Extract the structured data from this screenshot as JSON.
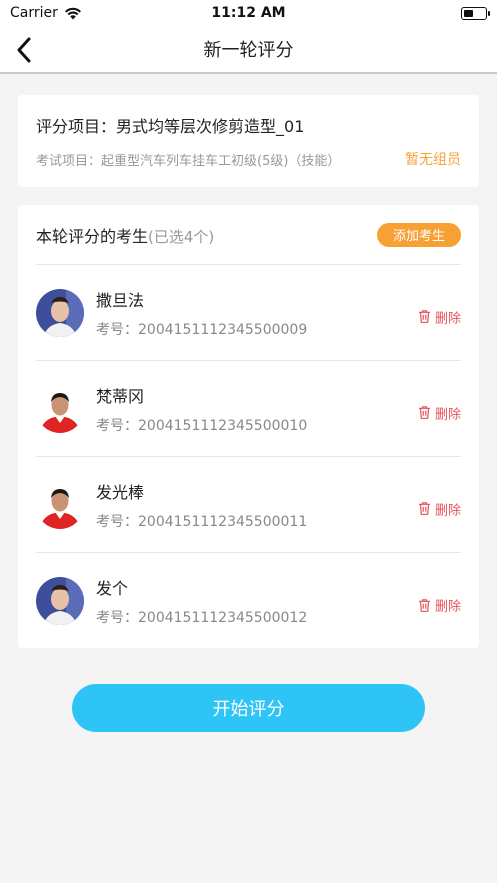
{
  "status_bar": {
    "carrier": "Carrier",
    "time": "11:12 AM"
  },
  "nav": {
    "title": "新一轮评分"
  },
  "project": {
    "label": "评分项目：",
    "name": "男式均等层次修剪造型_01",
    "exam_label": "考试项目：",
    "exam_name": "起重型汽车列车挂车工初级(5级)（技能）",
    "member_status": "暂无组员"
  },
  "students": {
    "title": "本轮评分的考生",
    "count_text": "(已选4个)",
    "add_label": "添加考生",
    "id_label": "考号：",
    "delete_label": "删除",
    "items": [
      {
        "name": "撒旦法",
        "id": "2004151112345500009",
        "avatar": "female-blue-background"
      },
      {
        "name": "梵蒂冈",
        "id": "2004151112345500010",
        "avatar": "male-red-shirt"
      },
      {
        "name": "发光棒",
        "id": "2004151112345500011",
        "avatar": "male-red-shirt"
      },
      {
        "name": "发个",
        "id": "2004151112345500012",
        "avatar": "female-blue-background"
      }
    ]
  },
  "actions": {
    "start_label": "开始评分"
  },
  "colors": {
    "accent_blue": "#2ec4f5",
    "accent_orange": "#f7a134",
    "delete_red": "#e8505b"
  }
}
